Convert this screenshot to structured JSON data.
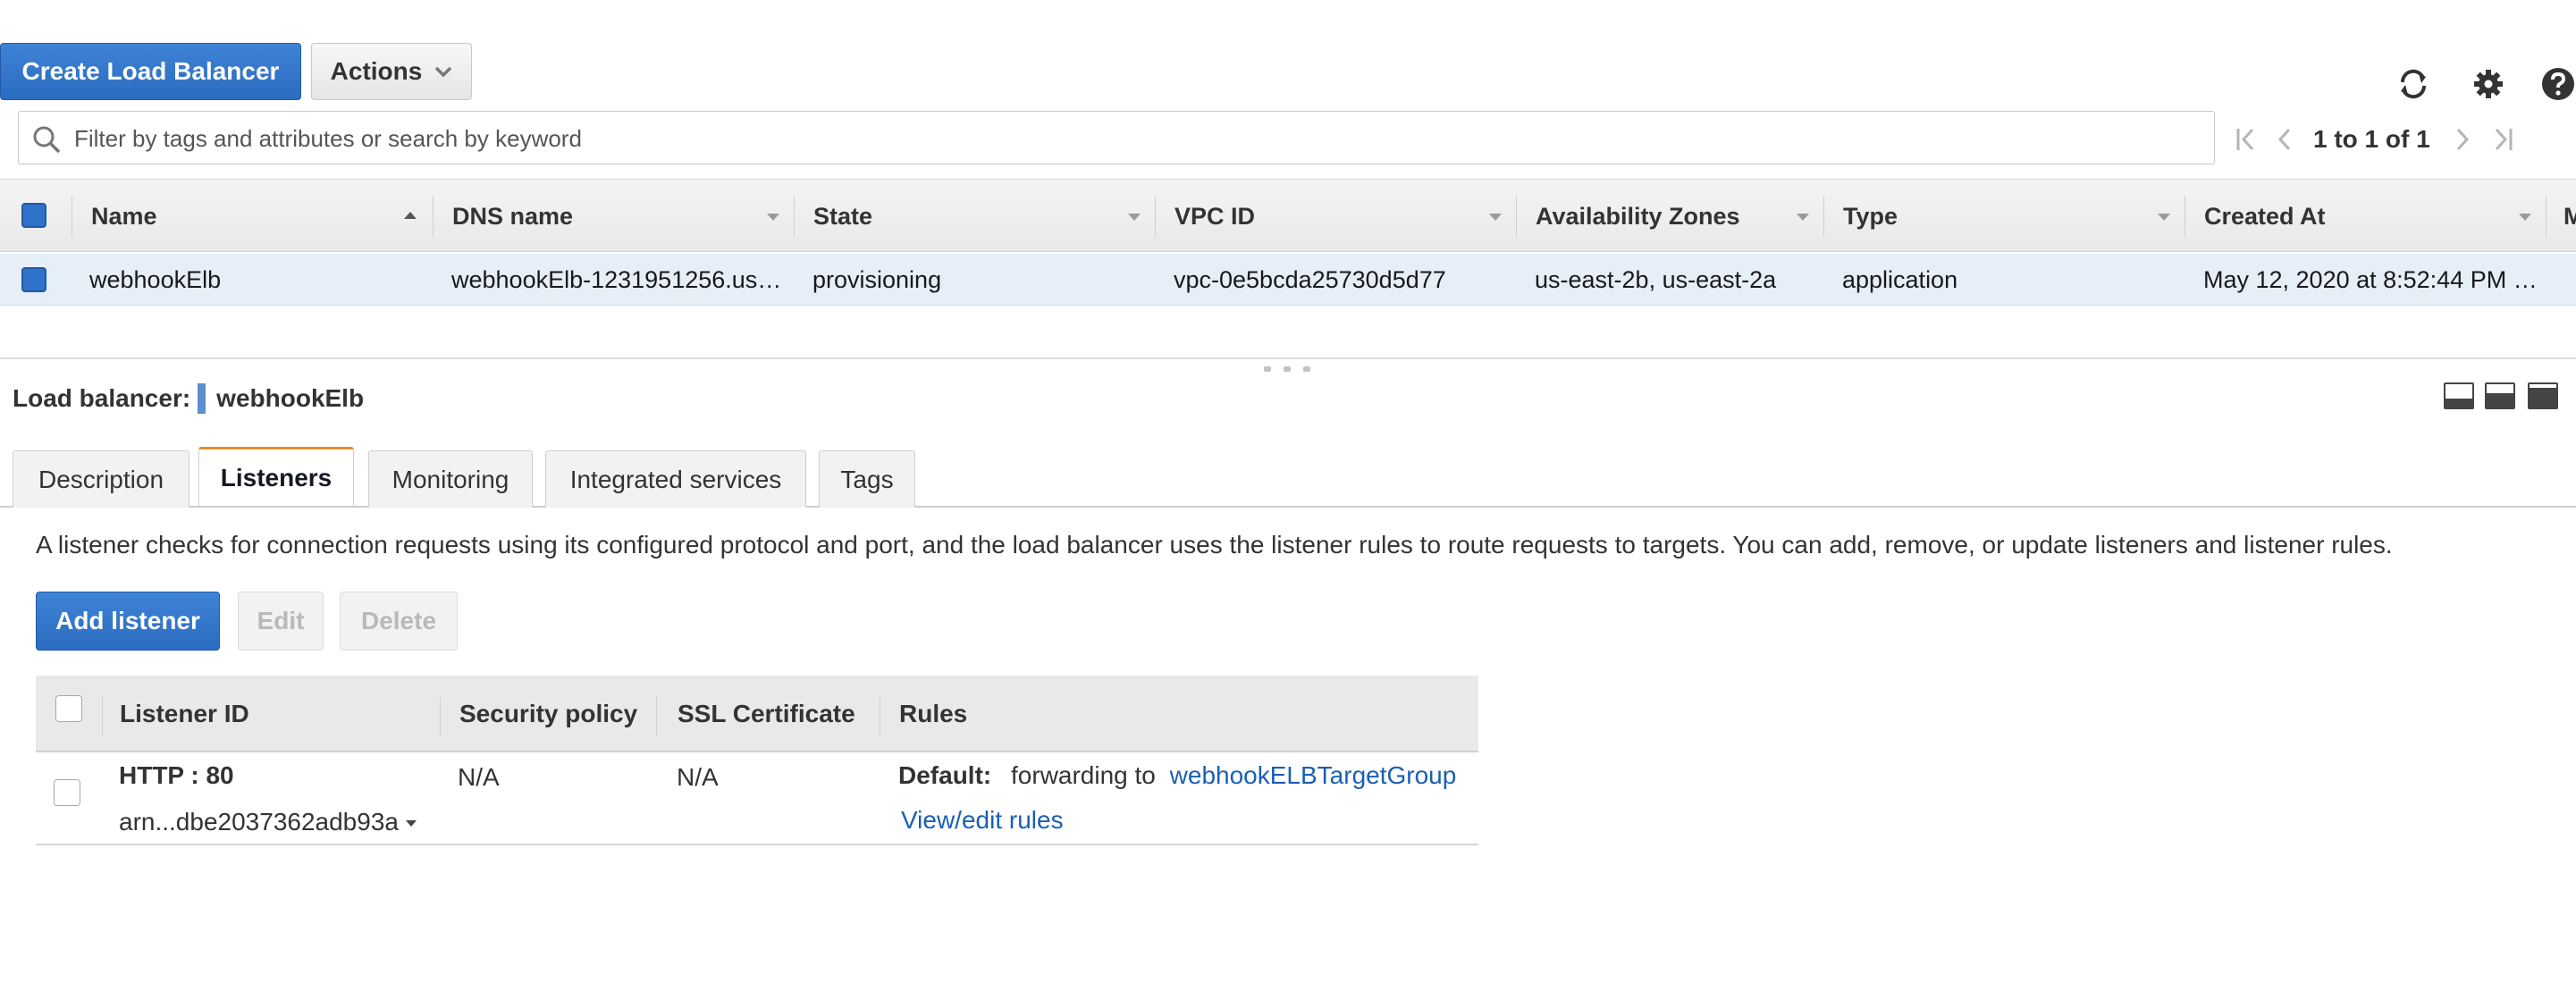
{
  "toolbar": {
    "create_label": "Create Load Balancer",
    "actions_label": "Actions",
    "icons": [
      "refresh-icon",
      "gear-icon",
      "help-icon"
    ]
  },
  "search": {
    "placeholder": "Filter by tags and attributes or search by keyword",
    "value": ""
  },
  "pagination": {
    "text": "1 to 1 of 1"
  },
  "load_balancers": {
    "columns": [
      "Name",
      "DNS name",
      "State",
      "VPC ID",
      "Availability Zones",
      "Type",
      "Created At",
      "M"
    ],
    "sort_column": "Name",
    "rows": [
      {
        "selected": true,
        "name": "webhookElb",
        "dns_name": "webhookElb-1231951256.us…",
        "state": "provisioning",
        "vpc_id": "vpc-0e5bcda25730d5d77",
        "availability_zones": "us-east-2b, us-east-2a",
        "type": "application",
        "created_at": "May 12, 2020 at 8:52:44 PM …"
      }
    ]
  },
  "detail": {
    "title_prefix": "Load balancer:",
    "title_name": "webhookElb",
    "tabs": [
      "Description",
      "Listeners",
      "Monitoring",
      "Integrated services",
      "Tags"
    ],
    "active_tab": "Listeners",
    "description": "A listener checks for connection requests using its configured protocol and port, and the load balancer uses the listener rules to route requests to targets. You can add, remove, or update listeners and listener rules.",
    "buttons": {
      "add": "Add listener",
      "edit": "Edit",
      "delete": "Delete"
    },
    "listeners_table": {
      "columns": [
        "Listener ID",
        "Security policy",
        "SSL Certificate",
        "Rules"
      ],
      "rows": [
        {
          "listener_id": "HTTP : 80",
          "arn": "arn...dbe2037362adb93a",
          "security_policy": "N/A",
          "ssl_certificate": "N/A",
          "rule_default_label": "Default:",
          "rule_text": "forwarding to",
          "rule_target": "webhookELBTargetGroup",
          "rule_link": "View/edit rules"
        }
      ]
    }
  },
  "colors": {
    "primary": "#2e73c9",
    "link": "#1a5fb4",
    "tab_accent": "#e48d2f",
    "selected_row": "#e6eef8"
  }
}
